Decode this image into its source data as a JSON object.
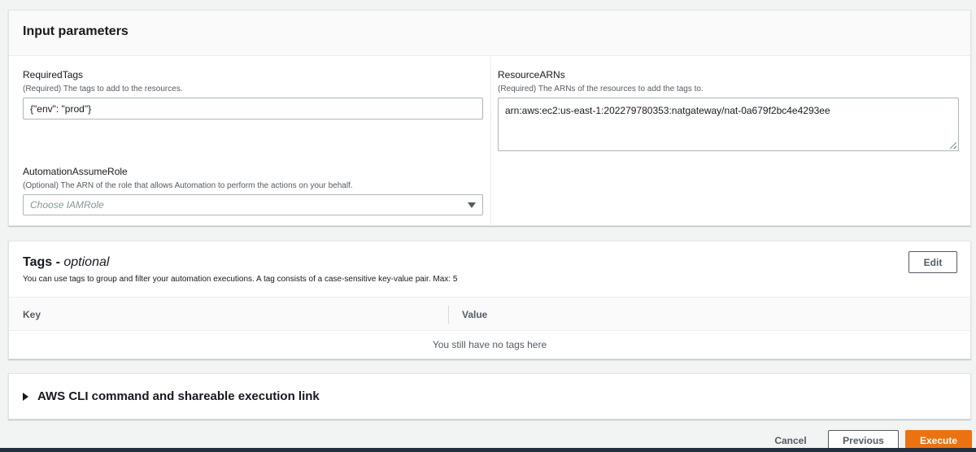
{
  "input_parameters": {
    "title": "Input parameters",
    "required_tags": {
      "label": "RequiredTags",
      "description": "(Required) The tags to add to the resources.",
      "value": "{\"env\": \"prod\"}"
    },
    "automation_assume_role": {
      "label": "AutomationAssumeRole",
      "description": "(Optional) The ARN of the role that allows Automation to perform the actions on your behalf.",
      "placeholder": "Choose IAMRole"
    },
    "resource_arns": {
      "label": "ResourceARNs",
      "description": "(Required) The ARNs of the resources to add the tags to.",
      "value": "arn:aws:ec2:us-east-1:202279780353:natgateway/nat-0a679f2bc4e4293ee"
    }
  },
  "tags": {
    "title": "Tags - ",
    "title_optional": "optional",
    "description": "You can use tags to group and filter your automation executions. A tag consists of a case-sensitive key-value pair. Max: 5",
    "edit_label": "Edit",
    "columns": [
      "Key",
      "Value"
    ],
    "empty_message": "You still have no tags here"
  },
  "cli_section": {
    "title": "AWS CLI command and shareable execution link"
  },
  "footer": {
    "cancel_label": "Cancel",
    "previous_label": "Previous",
    "execute_label": "Execute"
  },
  "colors": {
    "primary_button": "#ec7211",
    "page_background": "#f2f3f3"
  }
}
